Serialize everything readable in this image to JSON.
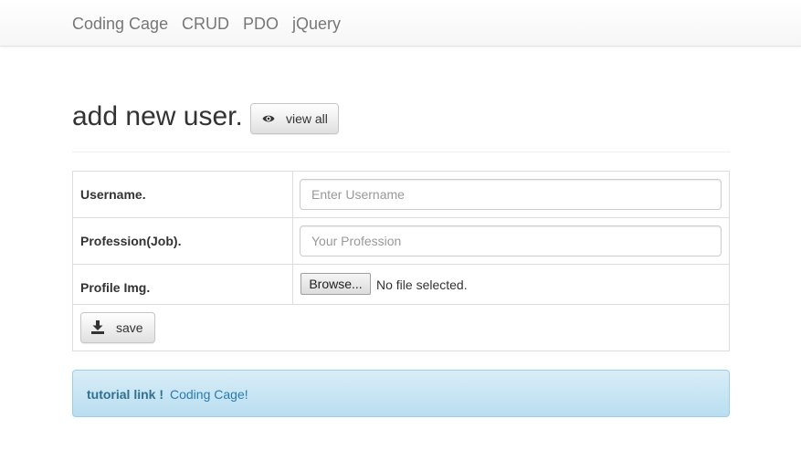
{
  "navbar": {
    "brand": "Coding Cage",
    "links": [
      {
        "label": "CRUD"
      },
      {
        "label": "PDO"
      },
      {
        "label": "jQuery"
      }
    ]
  },
  "page": {
    "title": "add new user.",
    "view_all_button": {
      "label": "view all",
      "icon": "eye-icon"
    }
  },
  "form": {
    "fields": [
      {
        "label": "Username.",
        "placeholder": "Enter Username",
        "value": ""
      },
      {
        "label": "Profession(Job).",
        "placeholder": "Your Profession",
        "value": ""
      },
      {
        "label": "Profile Img.",
        "browse_label": "Browse...",
        "file_status": "No file selected."
      }
    ],
    "save_button": {
      "label": "save",
      "icon": "download-icon"
    }
  },
  "alert": {
    "strong_text": "tutorial link !",
    "link_text": "Coding Cage!",
    "colors": {
      "background": "#d9edf7",
      "border": "#9acfea",
      "text": "#31708f"
    }
  }
}
